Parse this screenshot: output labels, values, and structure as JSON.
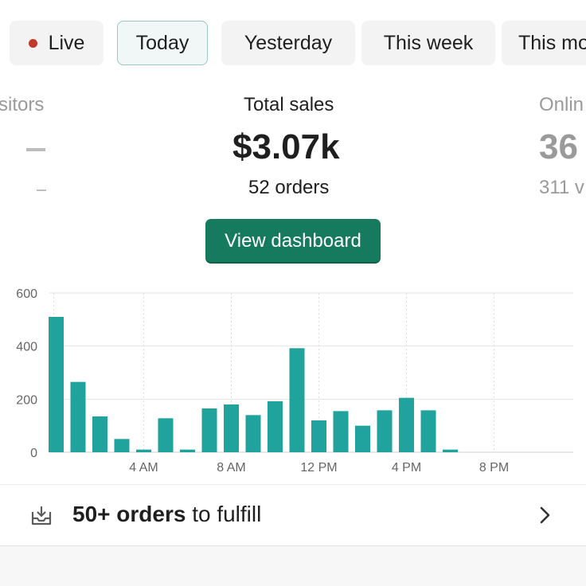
{
  "tabs": [
    {
      "label": "Live",
      "selected": false,
      "indicator_color": "#c0392b"
    },
    {
      "label": "Today",
      "selected": true
    },
    {
      "label": "Yesterday",
      "selected": false
    },
    {
      "label": "This week",
      "selected": false
    },
    {
      "label": "This mo",
      "selected": false
    }
  ],
  "metrics": {
    "visitors": {
      "label": "sitors"
    },
    "total_sales": {
      "label": "Total sales",
      "value": "$3.07k",
      "sub": "52 orders"
    },
    "online": {
      "label": "Onlin",
      "value": "36",
      "sub": "311 v"
    }
  },
  "view_dashboard_label": "View dashboard",
  "colors": {
    "accent": "#157a5e",
    "bar": "#1fa39c",
    "live_dot": "#c0392b"
  },
  "chart_data": {
    "type": "bar",
    "ylim": [
      0,
      600
    ],
    "yticks": [
      "0",
      "200",
      "400",
      "600"
    ],
    "xtick_labels": [
      "4 AM",
      "8 AM",
      "12 PM",
      "4 PM",
      "8 PM"
    ],
    "categories": [
      "0",
      "1",
      "2",
      "3",
      "4",
      "5",
      "6",
      "7",
      "8",
      "9",
      "10",
      "11",
      "12",
      "13",
      "14",
      "15",
      "16",
      "17",
      "18",
      "19",
      "20",
      "21",
      "22",
      "23"
    ],
    "values": [
      510,
      265,
      135,
      50,
      10,
      128,
      10,
      165,
      180,
      140,
      192,
      392,
      120,
      155,
      100,
      158,
      205,
      158,
      10,
      0,
      0,
      0,
      0,
      0
    ]
  },
  "fulfill": {
    "count": "50+ orders",
    "rest": " to fulfill"
  },
  "icons": {
    "fulfill": "download-tray-icon",
    "chevron": "chevron-right-icon"
  }
}
